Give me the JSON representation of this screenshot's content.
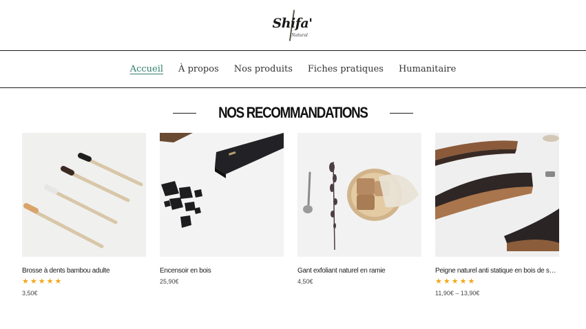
{
  "site": {
    "logo_text": "Shifa'",
    "logo_sub": "Natural"
  },
  "nav": {
    "items": [
      {
        "label": "Accueil",
        "active": true
      },
      {
        "label": "À propos",
        "active": false
      },
      {
        "label": "Nos produits",
        "active": false
      },
      {
        "label": "Fiches pratiques",
        "active": false
      },
      {
        "label": "Humanitaire",
        "active": false
      }
    ]
  },
  "section": {
    "title": "NOS RECOMMANDATIONS"
  },
  "products": [
    {
      "name": "Brosse à dents bambou adulte",
      "rating": 5,
      "stars": "★★★★★",
      "price": "3,50€"
    },
    {
      "name": "Encensoir en bois",
      "price": "25,90€"
    },
    {
      "name": "Gant exfoliant naturel en ramie",
      "price": "4,50€"
    },
    {
      "name": "Peigne naturel anti statique en bois de santal et corne",
      "rating": 5,
      "stars": "★★★★★",
      "price": "11,90€ – 13,90€"
    }
  ],
  "colors": {
    "accent": "#2e7d6b",
    "stars": "#f2a71b",
    "text": "#222222"
  },
  "icons": [
    "star-icon"
  ]
}
